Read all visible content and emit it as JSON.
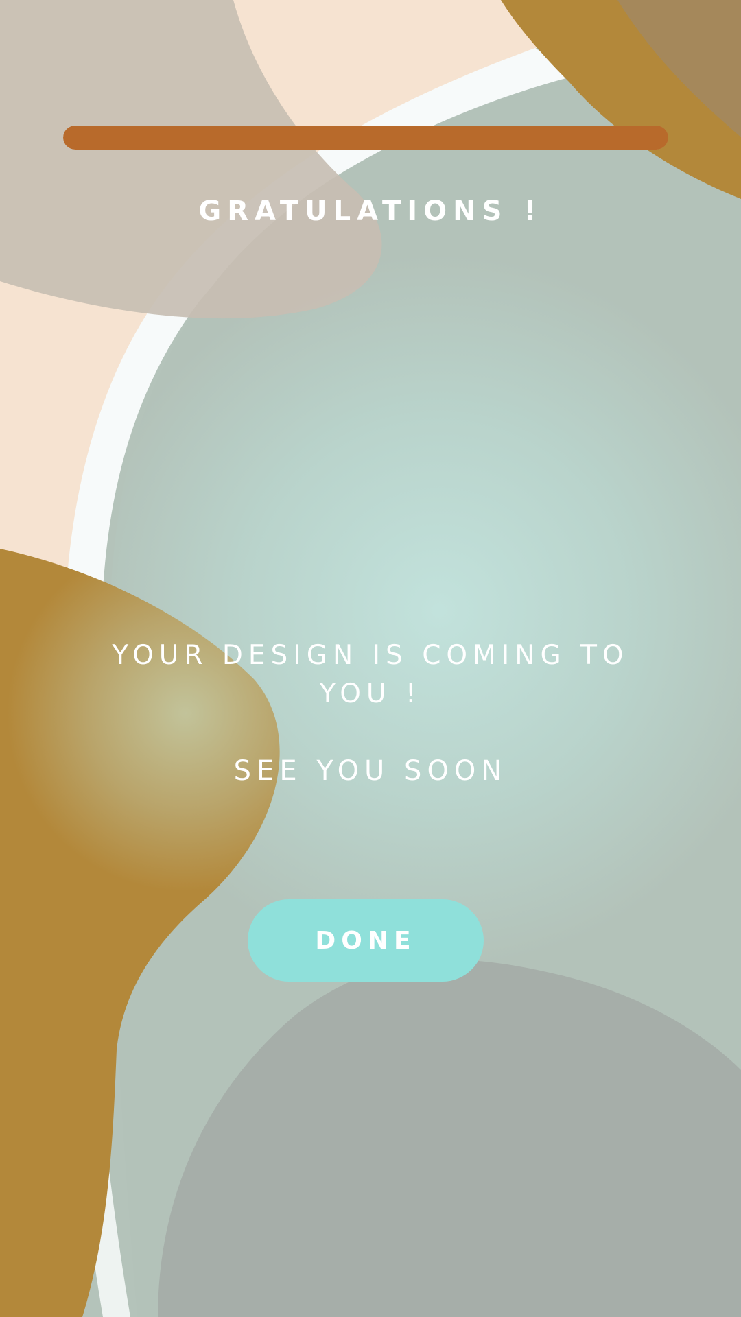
{
  "header": {
    "progress_percent": 100,
    "title": "GRATULATIONS !"
  },
  "main": {
    "message": "YOUR DESIGN IS COMING TO YOU !",
    "signoff": "SEE YOU SOON"
  },
  "actions": {
    "done_label": "DONE"
  },
  "colors": {
    "background": "#b4c3ba",
    "progress": "#b86a2b",
    "button": "#8fe0da",
    "text": "#ffffff",
    "accent_gold": "#b3873a",
    "peach": "#f5e3d1"
  }
}
